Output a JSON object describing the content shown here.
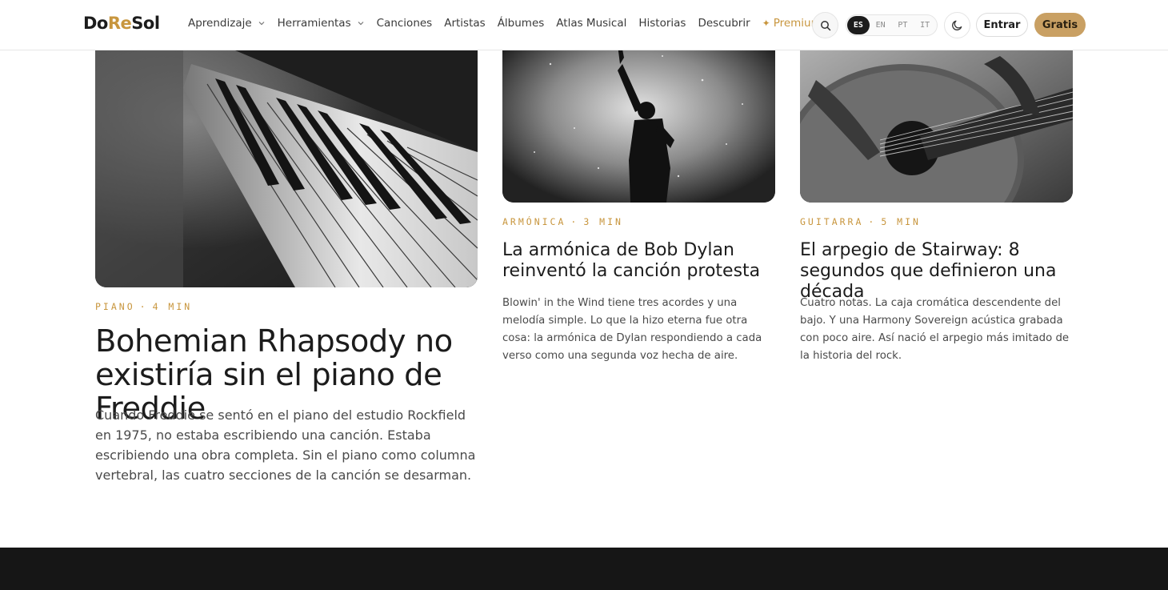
{
  "header": {
    "logo": {
      "part1": "Do",
      "part2": "Re",
      "part3": "Sol"
    },
    "nav": [
      {
        "label": "Aprendizaje",
        "dropdown": true
      },
      {
        "label": "Herramientas",
        "dropdown": true
      },
      {
        "label": "Canciones"
      },
      {
        "label": "Artistas"
      },
      {
        "label": "Álbumes"
      },
      {
        "label": "Atlas Musical"
      },
      {
        "label": "Historias"
      },
      {
        "label": "Descubrir"
      },
      {
        "label": "Premium",
        "icon": "star-icon"
      }
    ],
    "languages": [
      {
        "code": "ES",
        "active": true
      },
      {
        "code": "EN"
      },
      {
        "code": "PT"
      },
      {
        "code": "IT"
      }
    ],
    "login_label": "Entrar",
    "signup_label": "Gratis",
    "search_icon": "search-icon",
    "theme_icon": "moon-icon"
  },
  "colors": {
    "accent": "#c8963e",
    "signup_bg": "#c9a063",
    "footer_bg": "#161616"
  },
  "articles": {
    "featured": {
      "category": "PIANO",
      "read_time": "4 MIN",
      "title": "Bohemian Rhapsody no existiría sin el piano de Freddie",
      "excerpt": "Cuando Freddie se sentó en el piano del estudio Rockfield en 1975, no estaba escribiendo una canción. Estaba escribiendo una obra completa. Sin el piano como columna vertebral, las cuatro secciones de la canción se desarman.",
      "image": "piano-keys-photo"
    },
    "second": {
      "category": "ARMÓNICA",
      "read_time": "3 MIN",
      "title": "La armónica de Bob Dylan reinventó la canción protesta",
      "excerpt": "Blowin' in the Wind tiene tres acordes y una melodía simple. Lo que la hizo eterna fue otra cosa: la armónica de Dylan respondiendo a cada verso como una segunda voz hecha de aire.",
      "image": "concert-performer-photo"
    },
    "third": {
      "category": "GUITARRA",
      "read_time": "5 MIN",
      "title": "El arpegio de Stairway: 8 segundos que definieron una década",
      "excerpt": "Cuatro notas. La caja cromática descendente del bajo. Y una Harmony Sovereign acústica grabada con poco aire. Así nació el arpegio más imitado de la historia del rock.",
      "image": "acoustic-guitar-photo"
    }
  }
}
